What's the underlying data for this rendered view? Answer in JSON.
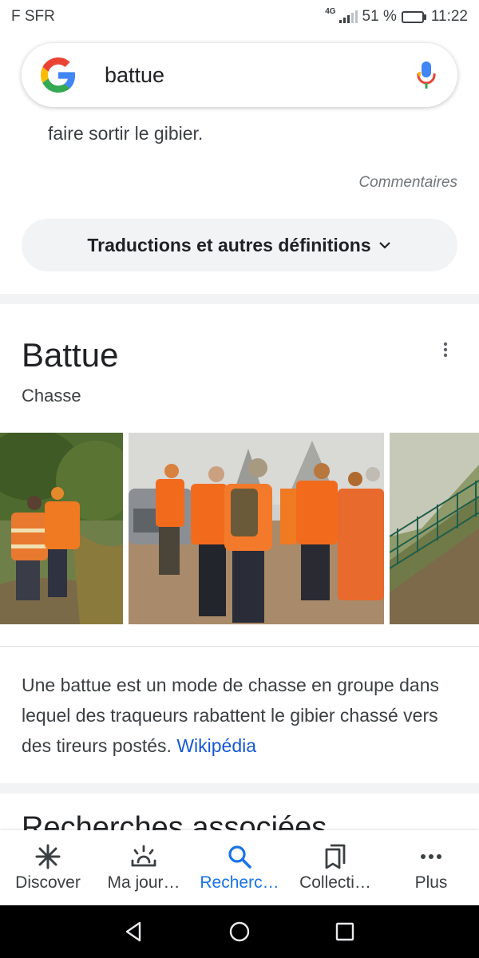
{
  "status_bar": {
    "carrier": "F SFR",
    "network": "4G",
    "battery_percent": "51 %",
    "battery_level": 0.51,
    "time": "11:22"
  },
  "search": {
    "query": "battue",
    "logo_icon": "google-g-icon",
    "mic_icon": "microphone-icon"
  },
  "definition_card": {
    "tail_text": "faire sortir le gibier.",
    "comments_label": "Commentaires",
    "more_button_label": "Traductions et autres définitions",
    "more_button_icon": "chevron-down-icon"
  },
  "knowledge_panel": {
    "title": "Battue",
    "subtitle": "Chasse",
    "menu_icon": "more-vert-icon",
    "images": [
      {
        "description_icon": "hunters-walking-image"
      },
      {
        "description_icon": "hunters-group-image"
      },
      {
        "description_icon": "fence-field-image"
      }
    ],
    "description": "Une battue est un mode de chasse en groupe dans lequel des traqueurs rabattent le gibier chassé vers des tireurs postés.",
    "source_link": "Wikipédia"
  },
  "related_searches": {
    "title": "Recherches associées"
  },
  "bottom_nav": {
    "items": [
      {
        "label": "Discover",
        "icon": "asterisk-icon",
        "active": false
      },
      {
        "label": "Ma jour…",
        "icon": "sunrise-icon",
        "active": false
      },
      {
        "label": "Recherc…",
        "icon": "search-icon",
        "active": true
      },
      {
        "label": "Collecti…",
        "icon": "bookmarks-icon",
        "active": false
      },
      {
        "label": "Plus",
        "icon": "more-horiz-icon",
        "active": false
      }
    ]
  },
  "colors": {
    "accent": "#1a73e8",
    "link": "#1558d6",
    "hunter_orange": "#f26b1d"
  }
}
